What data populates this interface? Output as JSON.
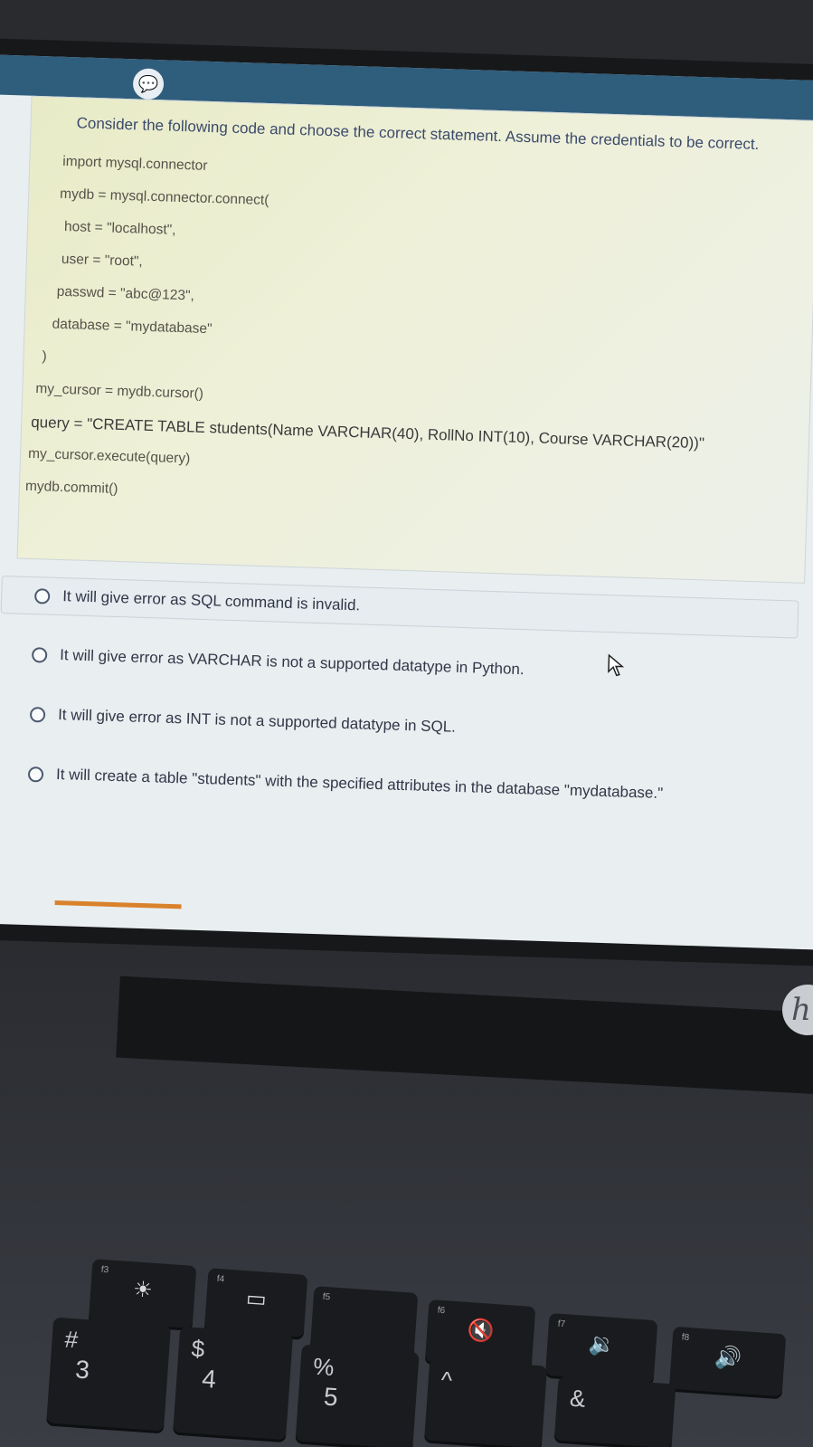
{
  "question": {
    "prompt": "Consider the following code and choose the correct statement. Assume the credentials to be correct.",
    "code": [
      "import mysql.connector",
      "mydb = mysql.connector.connect(",
      "host = \"localhost\",",
      "user = \"root\",",
      "passwd = \"abc@123\",",
      "database = \"mydatabase\"",
      ")",
      "my_cursor = mydb.cursor()",
      "query = \"CREATE TABLE students(Name VARCHAR(40), RollNo INT(10), Course VARCHAR(20))\"",
      "my_cursor.execute(query)",
      "mydb.commit()"
    ]
  },
  "options": [
    "It will give error as SQL command is invalid.",
    "It will give error as VARCHAR is not a supported datatype in Python.",
    "It will give error as INT is not a supported datatype in SQL.",
    "It will create a table \"students\" with the specified attributes in the database \"mydatabase.\""
  ],
  "icons": {
    "chat": "chat-bubble-icon",
    "cursor": "mouse-pointer-icon",
    "brand": "hp-logo-icon"
  },
  "keyboard": {
    "keys": [
      {
        "fn": "f3",
        "glyph": "☀",
        "top": "",
        "bottom": ""
      },
      {
        "fn": "f4",
        "glyph": "▭",
        "top": "#",
        "bottom": "3"
      },
      {
        "fn": "f5",
        "glyph": "",
        "top": "$",
        "bottom": "4"
      },
      {
        "fn": "f6",
        "glyph": "🔇",
        "top": "%",
        "bottom": "5"
      },
      {
        "fn": "f7",
        "glyph": "🔉",
        "top": "^",
        "bottom": ""
      },
      {
        "fn": "f8",
        "glyph": "🔊",
        "top": "&",
        "bottom": ""
      }
    ]
  },
  "colors": {
    "accent": "#2f5d7c",
    "progress": "#d9822b"
  }
}
